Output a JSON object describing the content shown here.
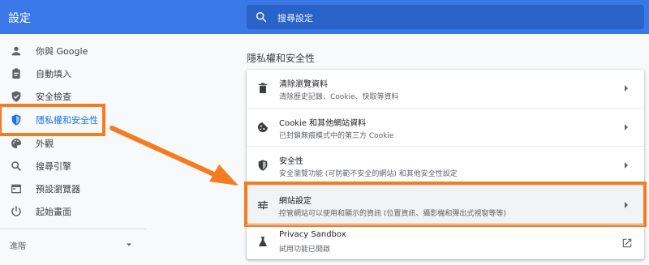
{
  "header": {
    "app_title": "設定",
    "search_placeholder": "搜尋設定"
  },
  "sidebar": {
    "items": [
      {
        "label": "你與 Google",
        "icon": "person-icon"
      },
      {
        "label": "自動填入",
        "icon": "clipboard-icon"
      },
      {
        "label": "安全檢查",
        "icon": "shield-check-icon"
      },
      {
        "label": "隱私權和安全性",
        "icon": "shield-privacy-icon",
        "active": true
      },
      {
        "label": "外觀",
        "icon": "palette-icon"
      },
      {
        "label": "搜尋引擎",
        "icon": "search-icon"
      },
      {
        "label": "預設瀏覽器",
        "icon": "browser-icon"
      },
      {
        "label": "起始畫面",
        "icon": "power-icon"
      }
    ],
    "advanced_label": "進階"
  },
  "main": {
    "section_title": "隱私權和安全性",
    "rows": [
      {
        "title": "清除瀏覽資料",
        "subtitle": "清除歷史記錄、Cookie、快取等資料",
        "icon": "trash-icon",
        "action": "chevron-right-icon"
      },
      {
        "title": "Cookie 和其他網站資料",
        "subtitle": "已封鎖無痕模式中的第三方 Cookie",
        "icon": "cookie-icon",
        "action": "chevron-right-icon"
      },
      {
        "title": "安全性",
        "subtitle": "安全瀏覽功能 (可防範不安全的網站) 和其他安全性設定",
        "icon": "shield-icon",
        "action": "chevron-right-icon"
      },
      {
        "title": "網站設定",
        "subtitle": "控管網站可以使用和顯示的資訊 (位置資訊、攝影機和彈出式視窗等等)",
        "icon": "tune-icon",
        "action": "chevron-right-icon",
        "highlighted": true
      },
      {
        "title": "Privacy Sandbox",
        "subtitle": "試用功能已開啟",
        "icon": "flask-icon",
        "action": "open-external-icon"
      }
    ]
  },
  "colors": {
    "header_bg": "#3b78e7",
    "accent": "#1a73e8",
    "annotation": "#f47b20"
  }
}
